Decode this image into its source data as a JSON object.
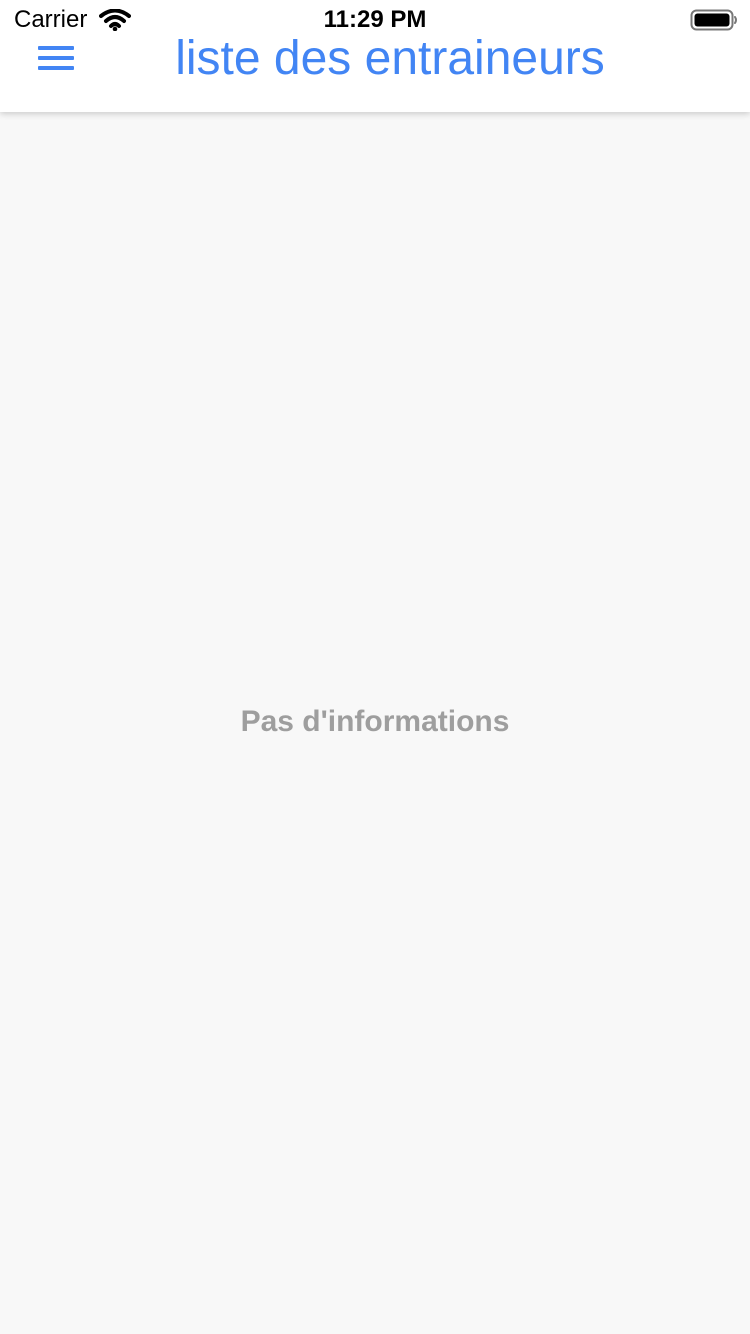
{
  "status_bar": {
    "carrier": "Carrier",
    "time": "11:29 PM",
    "wifi_icon": "wifi-icon",
    "battery_icon": "battery-icon"
  },
  "header": {
    "menu_icon": "hamburger-menu-icon",
    "title": "liste des entraineurs",
    "accent_color": "#4285f4"
  },
  "main": {
    "empty_message": "Pas d'informations",
    "message_color": "#9e9e9e",
    "background_color": "#f8f8f8"
  }
}
